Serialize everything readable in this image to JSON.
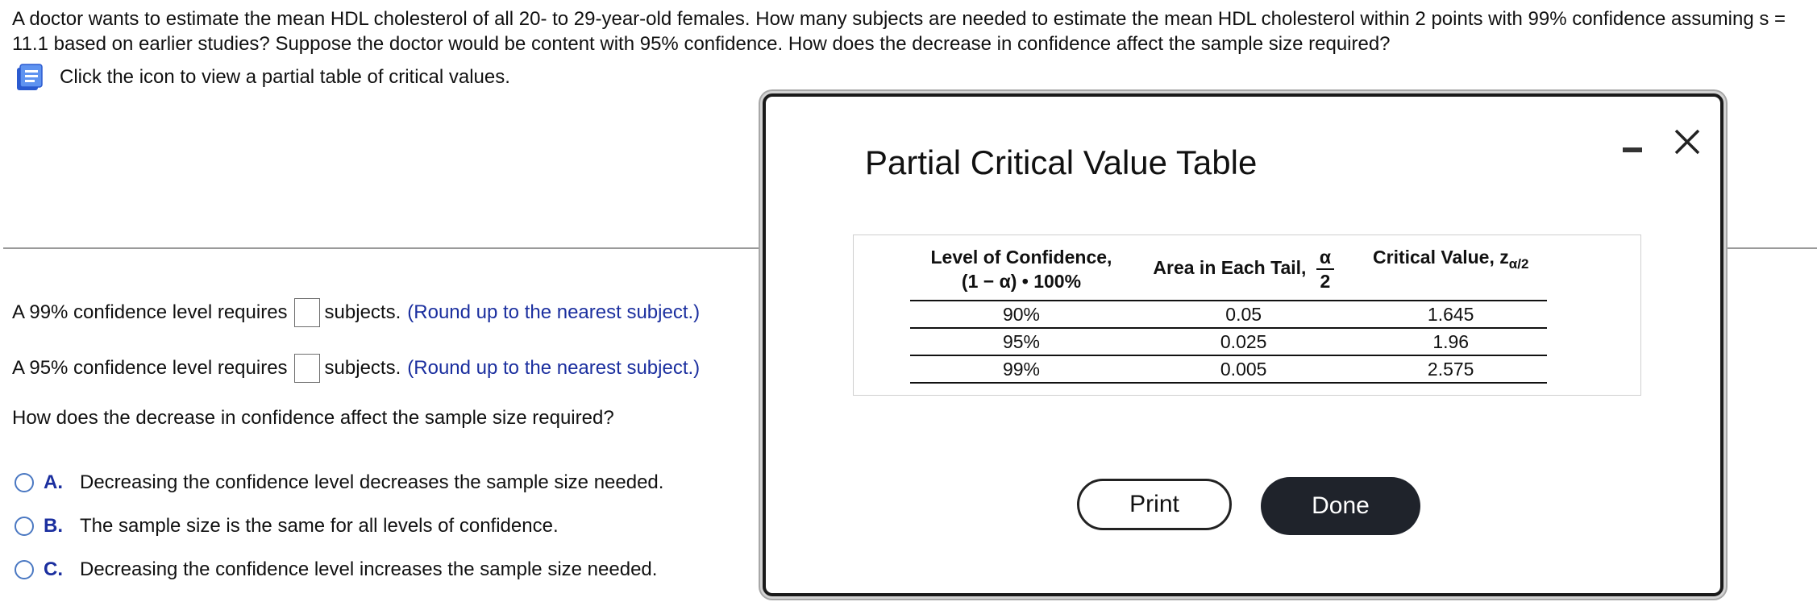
{
  "question": {
    "text": "A doctor wants to estimate the mean HDL cholesterol of all 20- to 29-year-old females. How many subjects are needed to estimate the mean HDL cholesterol within 2 points with 99% confidence assuming s = 11.1 based on earlier studies? Suppose the doctor would be content with 95% confidence. How does the decrease in confidence affect the sample size required?"
  },
  "hint": {
    "text": "Click the icon to view a partial table of critical values.",
    "icon": "book-icon"
  },
  "answers": [
    {
      "prefix": "A 99% confidence level requires",
      "value": "",
      "suffix": "subjects.",
      "round_hint": "(Round up to the nearest subject.)"
    },
    {
      "prefix": "A 95% confidence level requires",
      "value": "",
      "suffix": "subjects.",
      "round_hint": "(Round up to the nearest subject.)"
    }
  ],
  "sub_question": "How does the decrease in confidence affect the sample size required?",
  "choices": [
    {
      "letter": "A.",
      "text": "Decreasing the confidence level decreases the sample size needed."
    },
    {
      "letter": "B.",
      "text": "The sample size is the same for all levels of confidence."
    },
    {
      "letter": "C.",
      "text": "Decreasing the confidence level increases the sample size needed."
    }
  ],
  "modal": {
    "title": "Partial Critical Value Table",
    "headers": {
      "level_line1": "Level of Confidence,",
      "level_line2": "(1 − α) • 100%",
      "area": "Area in Each Tail,",
      "area_num": "α",
      "area_den": "2",
      "critical": "Critical Value, z",
      "critical_sub": "α/2"
    },
    "rows": [
      {
        "level": "90%",
        "area": "0.05",
        "critical": "1.645"
      },
      {
        "level": "95%",
        "area": "0.025",
        "critical": "1.96"
      },
      {
        "level": "99%",
        "area": "0.005",
        "critical": "2.575"
      }
    ],
    "print_label": "Print",
    "done_label": "Done"
  },
  "colors": {
    "link_blue": "#1b2f9f",
    "radio_blue": "#4a78c2",
    "done_bg": "#1f232b"
  }
}
